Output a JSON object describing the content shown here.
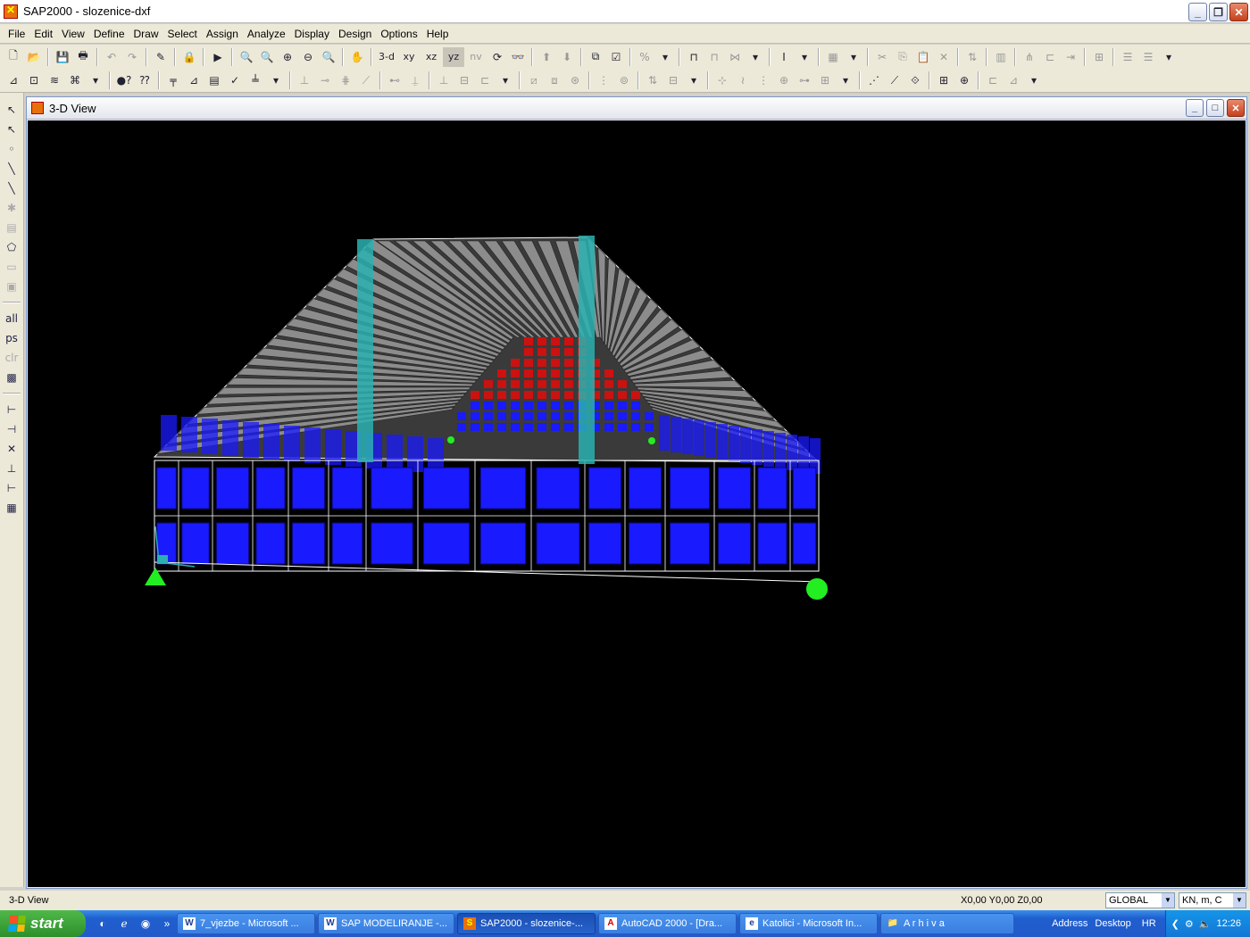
{
  "app": {
    "title": "SAP2000 - slozenice-dxf",
    "menus": [
      "File",
      "Edit",
      "View",
      "Define",
      "Draw",
      "Select",
      "Assign",
      "Analyze",
      "Display",
      "Design",
      "Options",
      "Help"
    ]
  },
  "toolbar": {
    "view_3d": "3-d",
    "view_xy": "xy",
    "view_xz": "xz",
    "view_yz": "yz",
    "view_nv": "nv"
  },
  "left_toolbar": {
    "all_label": "all",
    "ps_label": "ps",
    "clr_label": "clr"
  },
  "view_window": {
    "title": "3-D View",
    "canvas_bg": "#000000",
    "colors": {
      "roof": "#8c8c8c",
      "wall_panel": "#1a1aff",
      "back_wall": "#cc1111",
      "column": "#2ab0b0",
      "support": "#22ee22",
      "grid_line": "#ffffff"
    }
  },
  "status": {
    "left": "3-D View",
    "coords": "X0,00  Y0,00  Z0,00",
    "coord_system": "GLOBAL",
    "units": "KN, m, C"
  },
  "taskbar": {
    "start": "start",
    "tasks": [
      {
        "label": "7_vjezbe - Microsoft ...",
        "icon": "W"
      },
      {
        "label": "SAP  MODELIRANJE -...",
        "icon": "W"
      },
      {
        "label": "SAP2000 - slozenice-...",
        "icon": "S",
        "active": true
      },
      {
        "label": "AutoCAD 2000 - [Dra...",
        "icon": "A"
      },
      {
        "label": "Katolici - Microsoft In...",
        "icon": "e"
      },
      {
        "label": "A r h i v a",
        "icon": "📁"
      }
    ],
    "address_label": "Address",
    "address_value": "Desktop",
    "language": "HR",
    "clock": "12:26"
  }
}
